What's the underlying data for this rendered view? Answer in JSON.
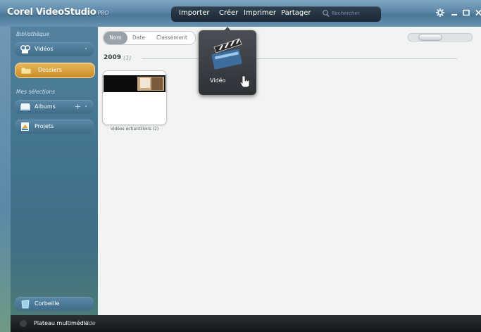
{
  "app": {
    "title": "Corel VideoStudio",
    "title_suffix": "PRO"
  },
  "menu": {
    "items": [
      "Importer",
      "Créer",
      "Imprimer",
      "Partager"
    ],
    "search_placeholder": "Rechercher"
  },
  "sidebar": {
    "library_heading": "Bibliothèque",
    "library_items": [
      {
        "label": "Vidéos",
        "icon": "video-icon"
      },
      {
        "label": "Dossiers",
        "icon": "folder-icon",
        "selected": true
      }
    ],
    "selections_heading": "Mes sélections",
    "selection_items": [
      {
        "label": "Albums",
        "icon": "album-icon"
      },
      {
        "label": "Projets",
        "icon": "project-icon"
      }
    ],
    "add_symbol": "+",
    "trash_label": "Corbeille"
  },
  "main": {
    "sort_tabs": [
      "Nom",
      "Date",
      "Classement"
    ],
    "active_sort": "Nom",
    "group": {
      "year": "2009",
      "count": "(1)"
    },
    "folders": [
      {
        "label": "Vidéos échantillons (2)"
      }
    ]
  },
  "popup": {
    "label": "Vidéo",
    "icon": "clapperboard-icon"
  },
  "status": {
    "label": "Plateau multimédia",
    "value": "Vide"
  },
  "colors": {
    "titlebar": "#5a86a8",
    "sidebar": "#447590",
    "selected_item": "#e8b85a",
    "statusbar": "#15181a"
  }
}
